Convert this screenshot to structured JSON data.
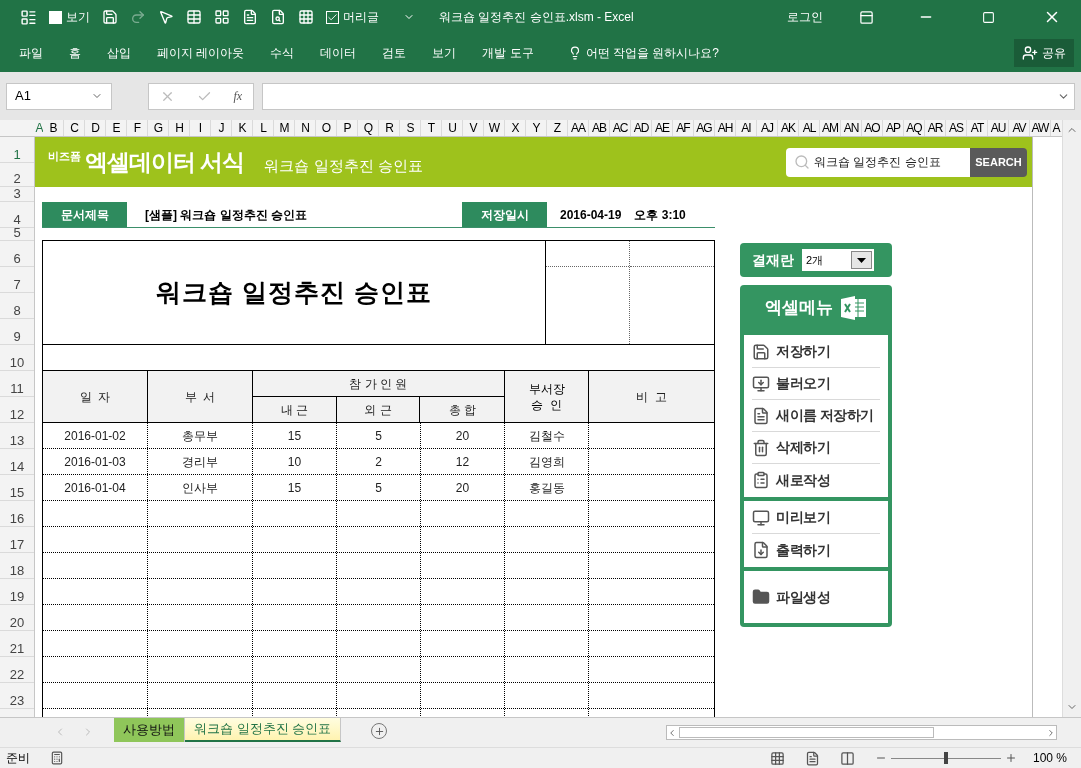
{
  "window": {
    "title": "워크숍 일정추진 승인표.xlsm - Excel",
    "login": "로그인"
  },
  "quick_access": [
    {
      "kind": "checkbox",
      "label": "보기",
      "checked": false
    },
    {
      "kind": "checkbox",
      "label": "머리글",
      "checked": true
    }
  ],
  "ribbon_tabs": [
    "파일",
    "홈",
    "삽입",
    "페이지 레이아웃",
    "수식",
    "데이터",
    "검토",
    "보기",
    "개발 도구"
  ],
  "tell_me": "어떤 작업을 원하시나요?",
  "share": "공유",
  "formula_bar": {
    "name_box": "A1",
    "fx": "fx"
  },
  "columns": [
    "A",
    "B",
    "C",
    "D",
    "E",
    "F",
    "G",
    "H",
    "I",
    "J",
    "K",
    "L",
    "M",
    "N",
    "O",
    "P",
    "Q",
    "R",
    "S",
    "T",
    "U",
    "V",
    "W",
    "X",
    "Y",
    "Z",
    "AA",
    "AB",
    "AC",
    "AD",
    "AE",
    "AF",
    "AG",
    "AH",
    "AI",
    "AJ",
    "AK",
    "AL",
    "AM",
    "AN",
    "AO",
    "AP",
    "AQ",
    "AR",
    "AS",
    "AT",
    "AU",
    "AV",
    "AW",
    "A"
  ],
  "rows": [
    "1",
    "2",
    "3",
    "4",
    "5",
    "6",
    "7",
    "8",
    "9",
    "10",
    "11",
    "12",
    "13",
    "14",
    "15",
    "16",
    "17",
    "18",
    "19",
    "20",
    "21",
    "22",
    "23"
  ],
  "banner": {
    "logo": "비즈폼",
    "title": "엑셀데이터 서식",
    "subtitle": "워크숍 일정추진 승인표",
    "search_value": "워크숍 일정추진 승인표",
    "search_button": "SEARCH"
  },
  "doc_info": {
    "title_label": "문서제목",
    "title_value": "[샘플] 워크숍 일정추진 승인표",
    "date_label": "저장일시",
    "date_value": "2016-04-19",
    "time_value": "오후 3:10"
  },
  "form": {
    "title": "워크숍 일정추진 승인표",
    "headers": {
      "date": "일  자",
      "dept": "부  서",
      "group": "참 가 인 원",
      "inner": "내 근",
      "outer": "외 근",
      "total": "총 합",
      "approval": [
        "부서장",
        "승  인"
      ],
      "note": "비  고"
    },
    "entries": [
      {
        "date": "2016-01-02",
        "dept": "총무부",
        "inner": "15",
        "outer": "5",
        "total": "20",
        "approver": "김철수"
      },
      {
        "date": "2016-01-03",
        "dept": "경리부",
        "inner": "10",
        "outer": "2",
        "total": "12",
        "approver": "김영희"
      },
      {
        "date": "2016-01-04",
        "dept": "인사부",
        "inner": "15",
        "outer": "5",
        "total": "20",
        "approver": "홍길동"
      }
    ]
  },
  "approval_box": {
    "label": "결재란",
    "value": "2개"
  },
  "menu": {
    "title": "엑셀메뉴",
    "groups": [
      [
        {
          "kind": "save",
          "label": "저장하기"
        },
        {
          "kind": "load",
          "label": "불러오기"
        },
        {
          "kind": "saveas",
          "label": "새이름 저장하기"
        },
        {
          "kind": "delete",
          "label": "삭제하기"
        },
        {
          "kind": "new",
          "label": "새로작성"
        }
      ],
      [
        {
          "kind": "preview",
          "label": "미리보기"
        },
        {
          "kind": "print",
          "label": "출력하기"
        }
      ],
      [
        {
          "kind": "folder",
          "label": "파일생성"
        }
      ]
    ]
  },
  "sheet_tabs": [
    {
      "label": "사용방법",
      "selected": false
    },
    {
      "label": "워크숍 일정추진 승인표",
      "selected": true
    }
  ],
  "status_bar": {
    "text": "준비",
    "zoom": "100 %",
    "zoom_slider": {
      "level": 0.5
    }
  }
}
